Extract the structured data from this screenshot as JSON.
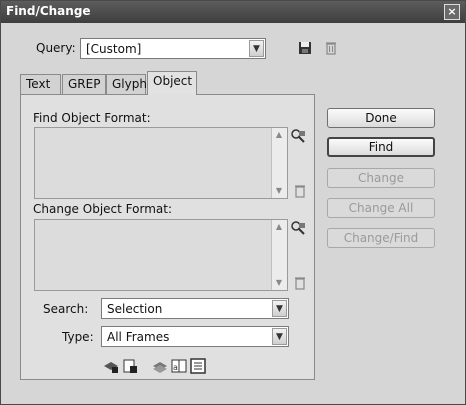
{
  "window": {
    "title": "Find/Change",
    "close_label": "×"
  },
  "query": {
    "label": "Query:",
    "value": "[Custom]"
  },
  "tabs": [
    {
      "label": "Text"
    },
    {
      "label": "GREP"
    },
    {
      "label": "Glyph"
    },
    {
      "label": "Object",
      "active": true
    }
  ],
  "find_format": {
    "label": "Find Object Format:"
  },
  "change_format": {
    "label": "Change Object Format:"
  },
  "search": {
    "label": "Search:",
    "value": "Selection"
  },
  "type": {
    "label": "Type:",
    "value": "All Frames"
  },
  "buttons": {
    "done": "Done",
    "find": "Find",
    "change": "Change",
    "change_all": "Change All",
    "change_find": "Change/Find"
  }
}
